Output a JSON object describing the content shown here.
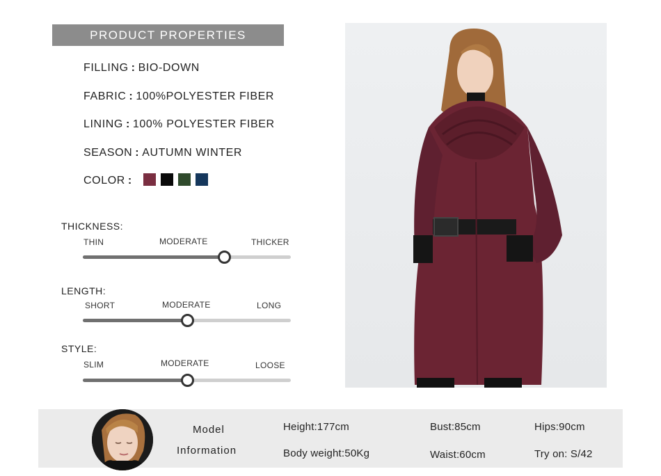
{
  "header": {
    "title": "PRODUCT PROPERTIES"
  },
  "properties": [
    {
      "label": "FILLING",
      "sep": ":",
      "value": "BIO-DOWN"
    },
    {
      "label": "FABRIC",
      "sep": ":",
      "value": "100%POLYESTER FIBER"
    },
    {
      "label": "LINING",
      "sep": ":",
      "value": "100% POLYESTER FIBER"
    },
    {
      "label": "SEASON",
      "sep": ":",
      "value": "AUTUMN WINTER"
    }
  ],
  "color": {
    "label": "COLOR",
    "sep": ":",
    "swatches": [
      "#7a2e41",
      "#0a0a0a",
      "#2f4a2c",
      "#15375c"
    ]
  },
  "scales": {
    "thickness": {
      "title": "THICKNESS:",
      "low": "THIN",
      "mid": "MODERATE",
      "high": "THICKER",
      "level": 0.68
    },
    "length": {
      "title": "LENGTH:",
      "low": "SHORT",
      "mid": "MODERATE",
      "high": "LONG",
      "level": 0.5
    },
    "style": {
      "title": "STYLE:",
      "low": "SLIM",
      "mid": "MODERATE",
      "high": "LOOSE",
      "level": 0.5
    }
  },
  "model": {
    "title_line1": "Model",
    "title_line2": "Information",
    "height": "Height:177cm",
    "weight": "Body weight:50Kg",
    "bust": "Bust:85cm",
    "waist": "Waist:60cm",
    "hips": "Hips:90cm",
    "try_on": "Try on:  S/42"
  },
  "colors": {
    "coat": "#6b2433",
    "header_band": "#8c8c8c",
    "info_band": "#ebebeb"
  }
}
